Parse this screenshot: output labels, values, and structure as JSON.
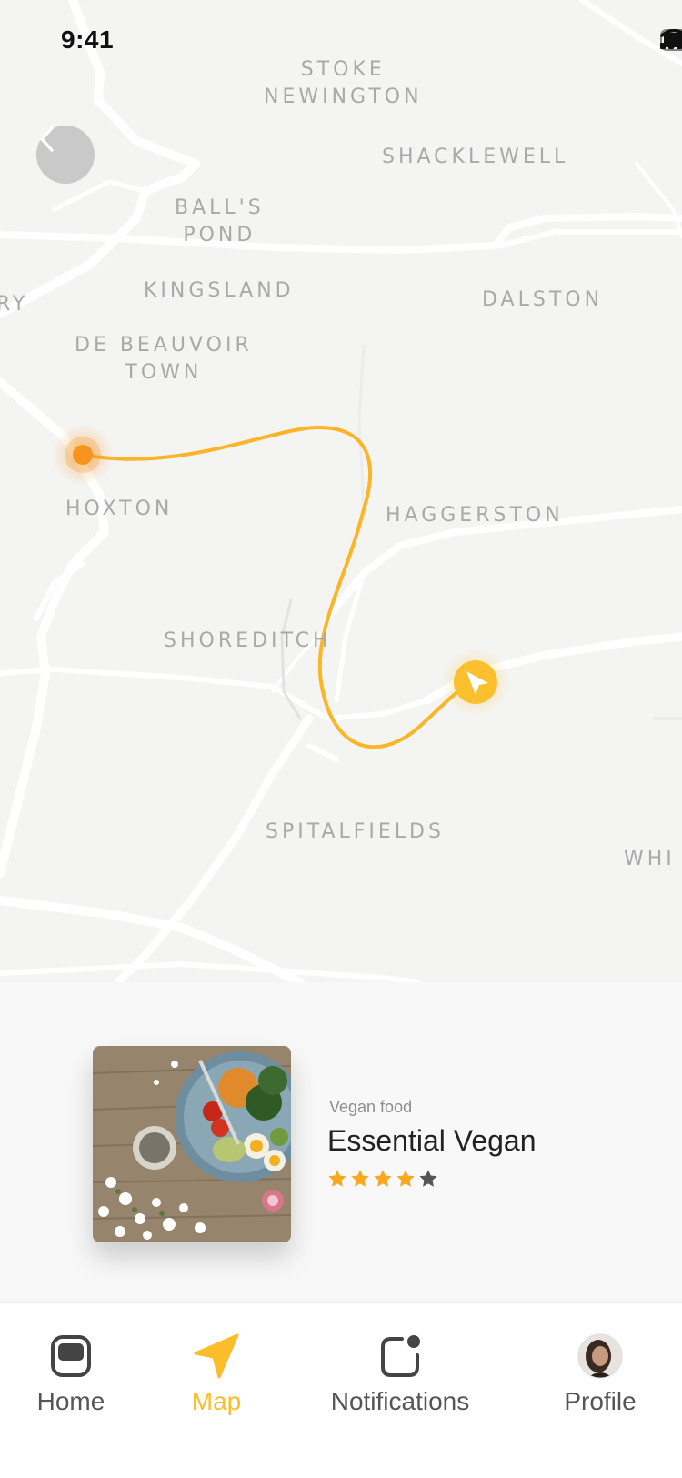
{
  "status_bar": {
    "time": "9:41"
  },
  "map": {
    "labels": {
      "stoke_newington": "STOKE\nNEWINGTON",
      "shacklewell": "SHACKLEWELL",
      "balls_pond": "BALL'S\nPOND",
      "kingsland": "KINGSLAND",
      "dalston": "DALSTON",
      "islington_partial": "RY",
      "de_beauvoir": "DE BEAUVOIR\nTOWN",
      "hoxton": "HOXTON",
      "haggerston": "HAGGERSTON",
      "shoreditch": "SHOREDITCH",
      "spitalfields": "SPITALFIELDS",
      "whitechapel_partial": "WHI"
    },
    "route_color": "#fbb527",
    "origin_color": "#f7931e"
  },
  "place_card": {
    "category": "Vegan food",
    "title": "Essential Vegan",
    "rating": 4,
    "rating_max": 5,
    "star_color": "#f8a81e",
    "empty_star_color": "#555555"
  },
  "tabs": [
    {
      "label": "Home"
    },
    {
      "label": "Map"
    },
    {
      "label": "Notifications"
    },
    {
      "label": "Profile"
    }
  ],
  "accent_color": "#fbbd2a"
}
